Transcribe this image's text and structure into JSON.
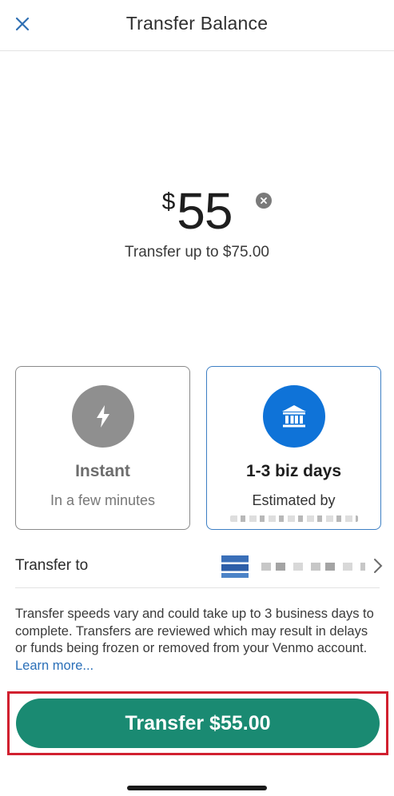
{
  "header": {
    "title": "Transfer Balance"
  },
  "amount": {
    "currency": "$",
    "value": "55",
    "limit_text": "Transfer up to $75.00"
  },
  "options": {
    "instant": {
      "title": "Instant",
      "subtitle": "In a few minutes",
      "icon": "lightning-bolt-icon"
    },
    "standard": {
      "title": "1-3 biz days",
      "subtitle": "Estimated by",
      "icon": "bank-icon"
    }
  },
  "transfer_to": {
    "label": "Transfer to"
  },
  "disclaimer": {
    "text": "Transfer speeds vary and could take up to 3 business days to complete. Transfers are reviewed which may result in delays or funds being frozen or removed from your Venmo account. ",
    "link": "Learn more..."
  },
  "action": {
    "label": "Transfer $55.00"
  },
  "colors": {
    "accent_green": "#1a8a72",
    "selected_blue": "#0f73d8",
    "highlight_red": "#d1202f"
  }
}
